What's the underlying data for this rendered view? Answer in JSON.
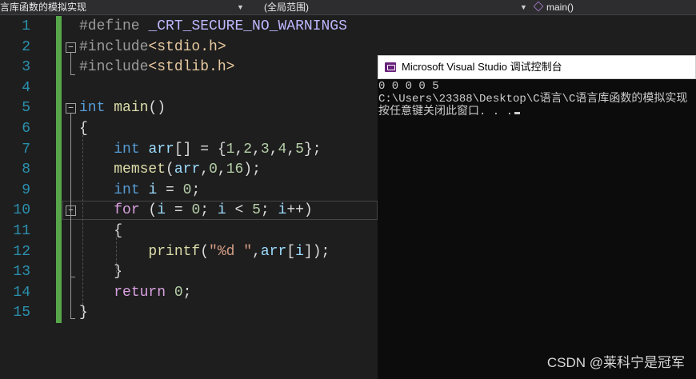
{
  "navbar": {
    "project": "言库函数的模拟实现",
    "scope": "(全局范围)",
    "function": "main()"
  },
  "editor": {
    "line_numbers": [
      "1",
      "2",
      "3",
      "4",
      "5",
      "6",
      "7",
      "8",
      "9",
      "10",
      "11",
      "12",
      "13",
      "14",
      "15"
    ],
    "lines": {
      "l1_directive": "#define",
      "l1_macro": "_CRT_SECURE_NO_WARNINGS",
      "l2_directive": "#include",
      "l2_header": "<stdio.h>",
      "l3_directive": "#include",
      "l3_header": "<stdlib.h>",
      "l5_type": "int",
      "l5_name": "main",
      "l5_parens": "()",
      "l6_brace": "{",
      "l7_type": "int",
      "l7_var": "arr",
      "l7_rest": "[] = {",
      "l7_values": [
        "1",
        "2",
        "3",
        "4",
        "5"
      ],
      "l7_end": "};",
      "l8_func": "memset",
      "l8_open": "(",
      "l8_var": "arr",
      "l8_sep1": ",",
      "l8_n1": "0",
      "l8_sep2": ",",
      "l8_n2": "16",
      "l8_end": ");",
      "l9_type": "int",
      "l9_var": "i",
      "l9_eq": " = ",
      "l9_num": "0",
      "l9_end": ";",
      "l10_kw": "for",
      "l10_open": " (",
      "l10_v1": "i",
      "l10_eq": " = ",
      "l10_n1": "0",
      "l10_semi1": "; ",
      "l10_v2": "i",
      "l10_lt": " < ",
      "l10_n2": "5",
      "l10_semi2": "; ",
      "l10_v3": "i",
      "l10_inc": "++)",
      "l11_brace": "{",
      "l12_func": "printf",
      "l12_open": "(",
      "l12_str": "\"%d \"",
      "l12_sep": ",",
      "l12_var": "arr",
      "l12_ob": "[",
      "l12_idx": "i",
      "l12_end": "]);",
      "l13_brace": "}",
      "l14_kw": "return",
      "l14_num": "0",
      "l14_end": ";",
      "l15_brace": "}"
    },
    "fold_markers": [
      "−",
      "−",
      "−"
    ]
  },
  "console": {
    "title": "Microsoft Visual Studio 调试控制台",
    "output": "0 0 0 0 5",
    "path": "C:\\Users\\23388\\Desktop\\C语言\\C语言库函数的模拟实现",
    "prompt": "按任意键关闭此窗口. . ."
  },
  "watermark": "CSDN @莱科宁是冠军",
  "colors": {
    "background": "#1e1e1e",
    "keyword": "#569cd6",
    "control": "#d8a0df",
    "function": "#dcdcaa",
    "variable": "#9cdcfe",
    "number": "#b5cea8",
    "string": "#d69d85",
    "line_number": "#2b91af",
    "change_bar": "#57a64a"
  },
  "icons": {
    "function_icon": "cube-icon",
    "console_icon": "vs-console-icon"
  }
}
